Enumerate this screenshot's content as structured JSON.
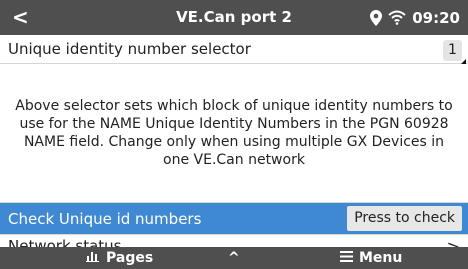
{
  "header": {
    "back_glyph": "<",
    "title": "VE.Can port 2",
    "time": "09:20",
    "icons": [
      "location-pin-icon",
      "wifi-icon"
    ]
  },
  "selector_row": {
    "label": "Unique identity number selector",
    "value": "1"
  },
  "description": "Above selector sets which block of unique identity numbers to use for the NAME Unique Identity Numbers in the PGN 60928 NAME field. Change only when using multiple GX Devices in one VE.Can network",
  "check_row": {
    "label": "Check Unique id numbers",
    "button_label": "Press to check"
  },
  "network_row": {
    "label": "Network status",
    "chevron": ">"
  },
  "footer": {
    "pages_label": "Pages",
    "up_glyph": "^",
    "menu_label": "Menu"
  },
  "colors": {
    "header_bg": "#4f4f4f",
    "highlight": "#3f88d2",
    "background": "#f3f3f3"
  }
}
